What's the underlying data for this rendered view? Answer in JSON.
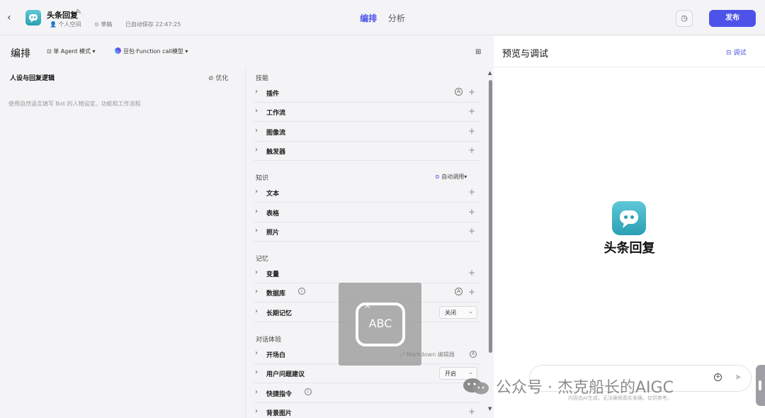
{
  "header": {
    "bot_name": "头条回复",
    "space": "个人空间",
    "status": "草稿",
    "autosave": "已自动保存 22:47:25",
    "tabs": [
      {
        "label": "编排"
      },
      {
        "label": "分析"
      }
    ],
    "publish_label": "发布"
  },
  "editbar": {
    "title": "编排",
    "mode": "单 Agent 模式",
    "model": "豆包·Function call模型"
  },
  "persona": {
    "title": "人设与回复逻辑",
    "optimize": "优化",
    "placeholder": "使用自然语言填写 Bot 的人物设定、功能和工作流程"
  },
  "skills": {
    "title": "技能",
    "items": [
      {
        "label": "插件"
      },
      {
        "label": "工作流"
      },
      {
        "label": "图像流"
      },
      {
        "label": "触发器"
      }
    ]
  },
  "knowledge": {
    "title": "知识",
    "auto_call": "自动调用",
    "items": [
      {
        "label": "文本"
      },
      {
        "label": "表格"
      },
      {
        "label": "照片"
      }
    ]
  },
  "memory": {
    "title": "记忆",
    "items": [
      {
        "label": "变量"
      },
      {
        "label": "数据库"
      },
      {
        "label": "长期记忆",
        "value": "关闭"
      }
    ]
  },
  "dialog": {
    "title": "对话体验",
    "items": [
      {
        "label": "开场白"
      },
      {
        "label": "用户问题建议",
        "value": "开启"
      },
      {
        "label": "快捷指令"
      },
      {
        "label": "背景图片"
      }
    ]
  },
  "overlay": {
    "abc": "ABC",
    "markdown_editor": "Markdown 编辑器"
  },
  "preview": {
    "title": "预览与调试",
    "debug": "调试",
    "bot_name": "头条回复",
    "disclaimer": "内容由AI生成，无法确保真实准确，仅供参考。"
  },
  "watermark": "公众号 · 杰克船长的AIGC",
  "colors": {
    "accent": "#4d53e8",
    "avatar": "#3fb3c6"
  }
}
